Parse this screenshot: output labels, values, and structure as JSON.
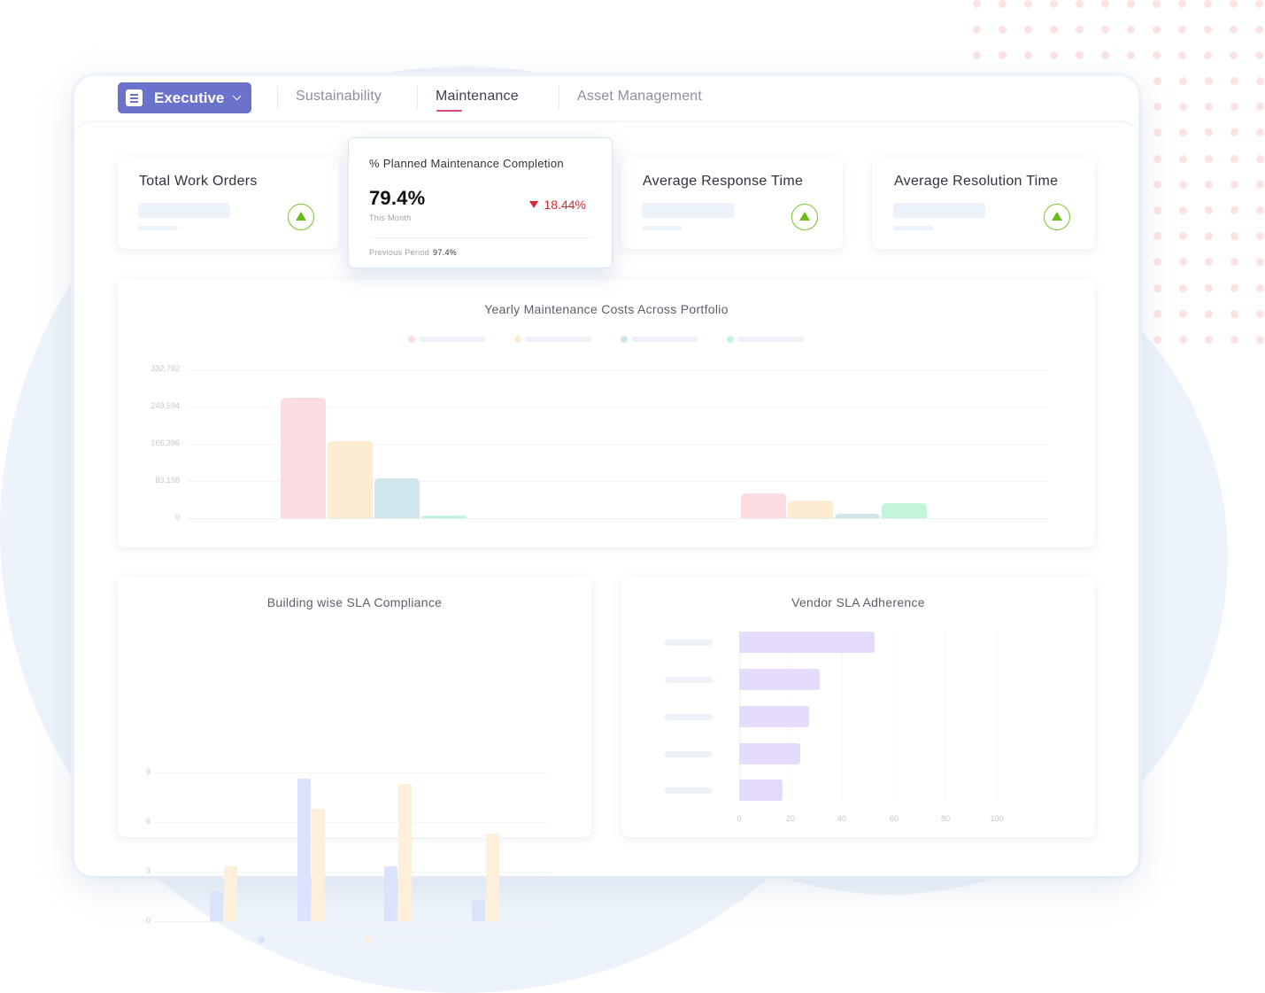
{
  "colors": {
    "accent": "#6b72cc",
    "tab_underline": "#e0457b",
    "trend_up": "#6dbb19",
    "trend_down": "#d7282f",
    "background_circle": "#edf3fa",
    "dot": "#fde2e2"
  },
  "nav": {
    "dashboard_selector": {
      "label": "Executive",
      "icon": "document-icon",
      "caret": "chevron-down-icon"
    },
    "tabs": [
      {
        "label": "Sustainability",
        "active": false
      },
      {
        "label": "Maintenance",
        "active": true
      },
      {
        "label": "Asset Management",
        "active": false
      }
    ]
  },
  "kpis": [
    {
      "title": "Total Work Orders",
      "trend": "up",
      "loading": true
    },
    {
      "title": "Average Response Time",
      "trend": "up",
      "loading": true
    },
    {
      "title": "Average Resolution Time",
      "trend": "up",
      "loading": true
    }
  ],
  "featured_kpi": {
    "title": "% Planned Maintenance Completion",
    "value": "79.4%",
    "period_label": "This Month",
    "delta": "18.44%",
    "delta_direction": "down",
    "previous_label": "Previous Period",
    "previous_value": "97.4%"
  },
  "chart_data": [
    {
      "type": "bar",
      "title": "Yearly Maintenance Costs Across Portfolio",
      "xlabel": "",
      "ylabel": "",
      "ylim": [
        0,
        332792
      ],
      "yticks": [
        "0",
        "83,198",
        "166,396",
        "249,594",
        "332,792"
      ],
      "ytick_values": [
        0,
        83198,
        166396,
        249594,
        332792
      ],
      "grid": true,
      "legend": "top",
      "categories": [
        "",
        ""
      ],
      "series": [
        {
          "name": "",
          "color": "#fddde1",
          "values": [
            269400,
            55500
          ]
        },
        {
          "name": "",
          "color": "#fdebd2",
          "values": [
            172300,
            39600
          ]
        },
        {
          "name": "",
          "color": "#cfe6ec",
          "values": [
            89100,
            9900
          ]
        },
        {
          "name": "",
          "color": "#c3f4dc",
          "values": [
            5900,
            33700
          ]
        }
      ]
    },
    {
      "type": "bar",
      "title": "Building wise SLA Compliance",
      "xlabel": "",
      "ylabel": "",
      "ylim": [
        0,
        9
      ],
      "yticks": [
        "0",
        "3",
        "6",
        "9"
      ],
      "ytick_values": [
        0,
        3,
        6,
        9
      ],
      "grid": true,
      "legend": "bottom",
      "categories": [
        "",
        "",
        "",
        ""
      ],
      "series": [
        {
          "name": "",
          "color": "#dbe2fb",
          "values": [
            1.8,
            8.6,
            3.3,
            1.3
          ]
        },
        {
          "name": "",
          "color": "#fdefd9",
          "values": [
            3.3,
            6.8,
            8.3,
            5.3
          ]
        }
      ]
    },
    {
      "type": "bar",
      "orientation": "horizontal",
      "title": "Vendor SLA Adherence",
      "xlabel": "",
      "ylabel": "",
      "xlim": [
        0,
        100
      ],
      "xticks": [
        "0",
        "20",
        "40",
        "60",
        "80",
        "100"
      ],
      "xtick_values": [
        0,
        20,
        40,
        60,
        80,
        100
      ],
      "grid": true,
      "legend": "none",
      "categories": [
        "",
        "",
        "",
        "",
        ""
      ],
      "series": [
        {
          "name": "",
          "color": "#e5dbfb",
          "values": [
            52.6,
            31.3,
            27.1,
            23.7,
            16.8
          ]
        }
      ]
    }
  ]
}
